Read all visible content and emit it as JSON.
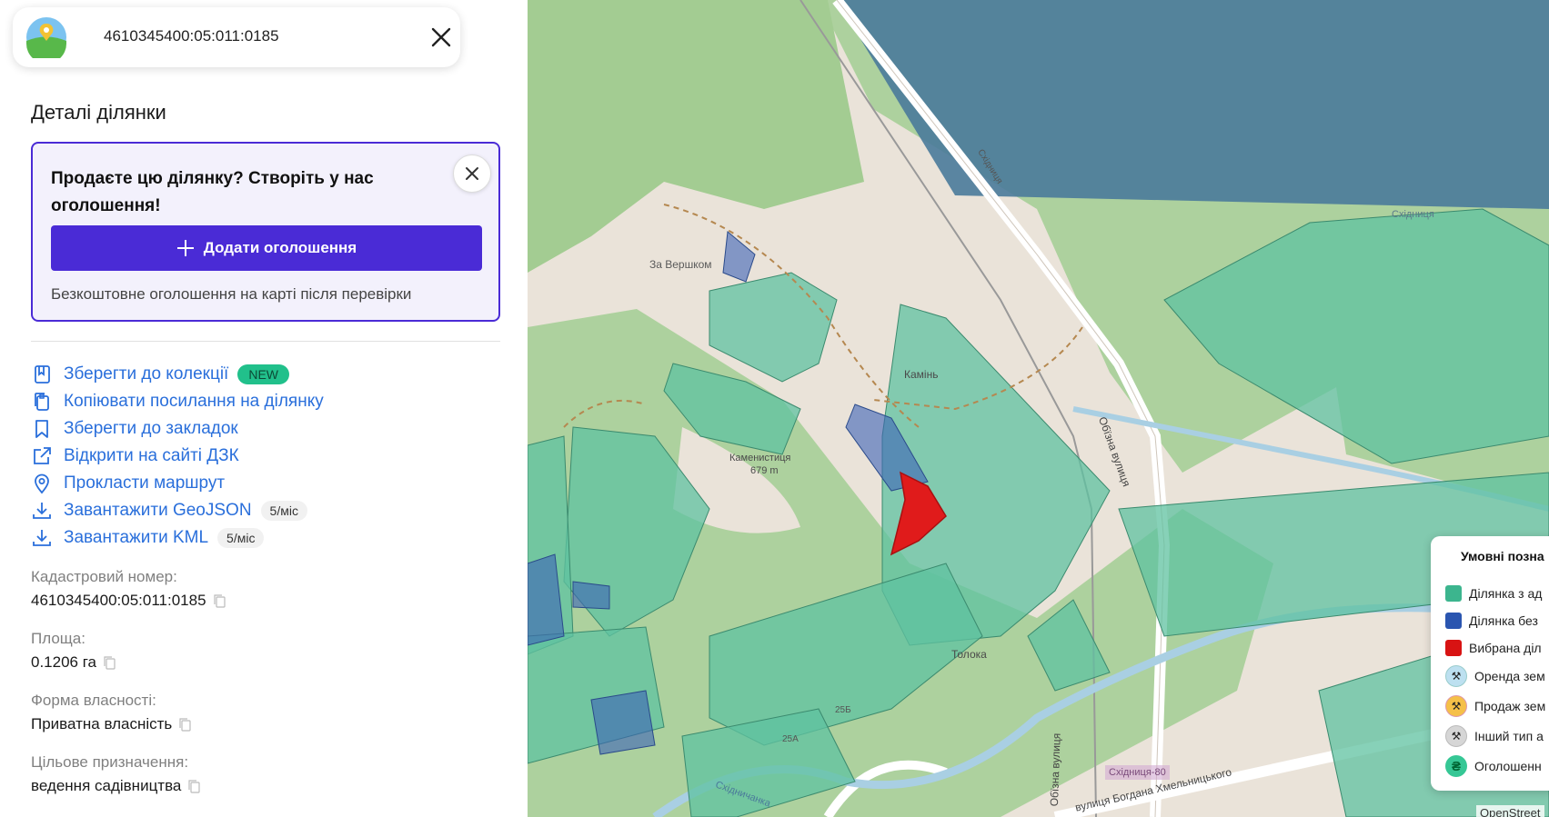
{
  "search": {
    "value": "4610345400:05:011:0185"
  },
  "sidebar": {
    "title": "Деталі ділянки",
    "promo": {
      "title": "Продаєте цю ділянку? Створіть у нас оголошення!",
      "button_label": "Додати оголошення",
      "note": "Безкоштовне оголошення на карті після перевірки"
    },
    "actions": [
      {
        "label": "Зберегти до колекції",
        "icon": "collection-icon",
        "badge": "NEW"
      },
      {
        "label": "Копіювати посилання на ділянку",
        "icon": "copy-link-icon"
      },
      {
        "label": "Зберегти до закладок",
        "icon": "bookmark-icon"
      },
      {
        "label": "Відкрити на сайті ДЗК",
        "icon": "external-link-icon"
      },
      {
        "label": "Прокласти маршрут",
        "icon": "location-pin-icon"
      },
      {
        "label": "Завантажити GeoJSON",
        "icon": "download-icon",
        "badge": "5/міс"
      },
      {
        "label": "Завантажити KML",
        "icon": "download-icon",
        "badge": "5/міс"
      }
    ],
    "info": [
      {
        "label": "Кадастровий номер:",
        "value": "4610345400:05:011:0185"
      },
      {
        "label": "Площа:",
        "value": "0.1206 га"
      },
      {
        "label": "Форма власності:",
        "value": "Приватна власність"
      },
      {
        "label": "Цільове призначення:",
        "value": "ведення садівництва"
      }
    ]
  },
  "map": {
    "labels": {
      "za_vershkom": "За Вершком",
      "kamin": "Камінь",
      "kamenystytsia": "Каменистиця",
      "elevation": "679 m",
      "toloka": "Толока",
      "skhidnytsia_road": "Східниця",
      "skhidnytsia_top": "Східниця",
      "obizna": "Обїзна вулиця",
      "obizna_lower": "Обїзна вулиця",
      "skhidnytsia80": "Східниця-80",
      "khmelnytskoho": "вулиця Богдана Хмельницького",
      "skhidnychanka": "Східничанка",
      "num_25b": "25Б",
      "num_25a": "25А"
    },
    "colors": {
      "parcel_with_address": "#5fc1a0",
      "parcel_without_address": "#3c63b8",
      "selected_parcel": "#e01b1b",
      "forest": "#add19e",
      "land": "#eae3d9",
      "water_area": "#4a7a9a"
    }
  },
  "legend": {
    "title": "Умовні позна",
    "items": [
      {
        "label": "Ділянка з ад",
        "color": "#3cb58e",
        "kind": "swatch"
      },
      {
        "label": "Ділянка без",
        "color": "#2a55b0",
        "kind": "swatch"
      },
      {
        "label": "Вибрана діл",
        "color": "#d81313",
        "kind": "swatch"
      },
      {
        "label": "Оренда зем",
        "color": "#bde0f0",
        "kind": "circle",
        "icon": "auction-icon"
      },
      {
        "label": "Продаж зем",
        "color": "#f5c048",
        "kind": "circle",
        "icon": "auction-icon"
      },
      {
        "label": "Інший тип а",
        "color": "#d6d6d6",
        "kind": "circle",
        "icon": "auction-icon"
      },
      {
        "label": "Оголошенн",
        "color": "#36c795",
        "kind": "circle",
        "icon": "hryvnia-icon",
        "glyph": "₴"
      }
    ]
  },
  "attribution": "OpenStreet"
}
